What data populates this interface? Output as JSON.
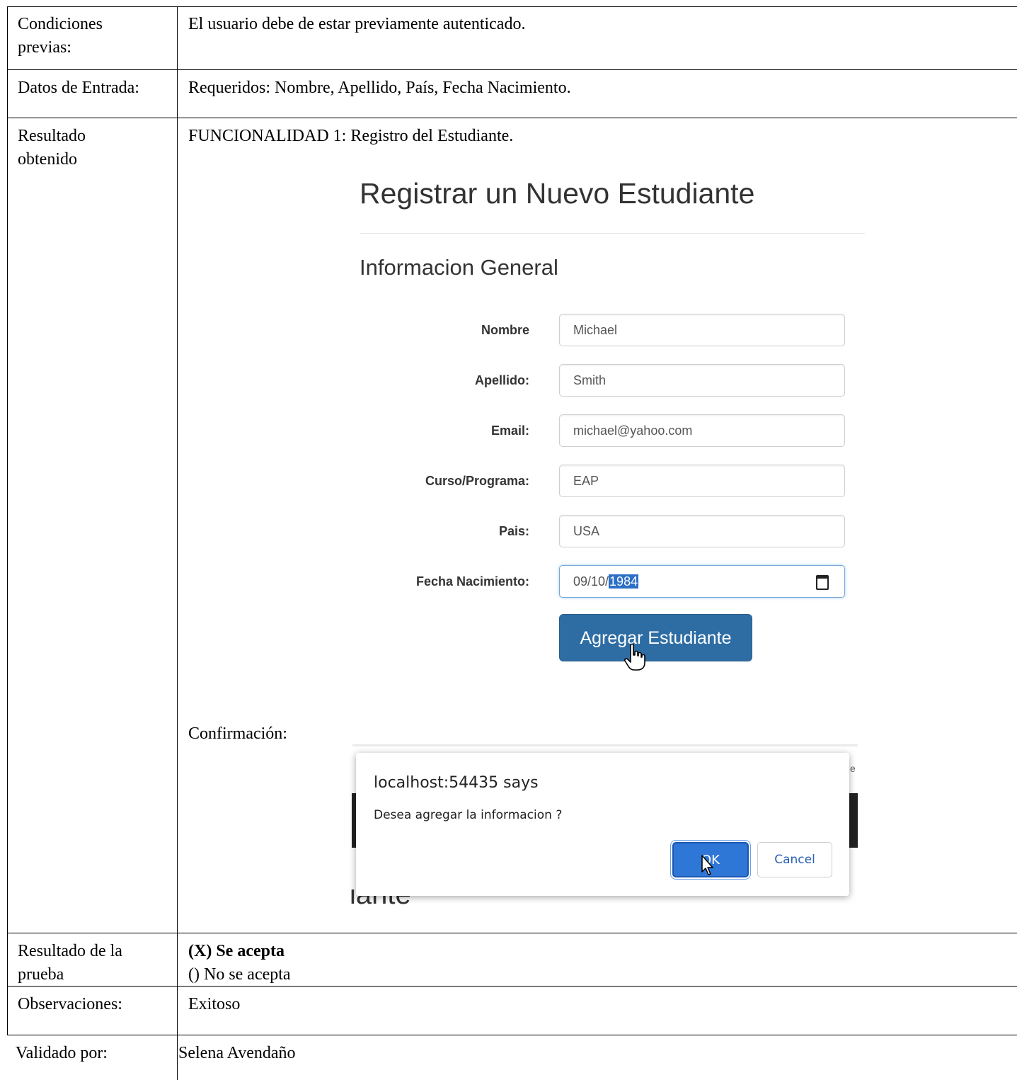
{
  "rows": {
    "precondiciones": {
      "label_line1": "Condiciones",
      "label_line2": "previas:",
      "value": "El usuario debe de estar previamente autenticado."
    },
    "entrada": {
      "label": "Datos de Entrada:",
      "value": "Requeridos: Nombre, Apellido, País, Fecha Nacimiento."
    },
    "resultado_obtenido": {
      "label_line1": "Resultado",
      "label_line2": "obtenido",
      "heading": "FUNCIONALIDAD 1: Registro del Estudiante.",
      "confirmacion_label": "Confirmación:"
    },
    "resultado_prueba": {
      "label_line1": "Resultado de la",
      "label_line2": "prueba",
      "accepted": "(X) Se acepta",
      "rejected": "() No se acepta"
    },
    "observaciones": {
      "label": "Observaciones:",
      "value": "Exitoso"
    },
    "validado": {
      "label": "Validado por:",
      "value": "Selena Avendaño"
    }
  },
  "form": {
    "title": "Registrar un Nuevo Estudiante",
    "subtitle": "Informacion General",
    "fields": [
      {
        "label": "Nombre",
        "value": "Michael"
      },
      {
        "label": "Apellido:",
        "value": "Smith"
      },
      {
        "label": "Email:",
        "value": "michael@yahoo.com"
      },
      {
        "label": "Curso/Programa:",
        "value": "EAP"
      },
      {
        "label": "Pais:",
        "value": "USA"
      },
      {
        "label": "Fecha Nacimiento:",
        "value_prefix": "09/10/",
        "value_selected": "1984"
      }
    ],
    "submit_label": "Agregar Estudiante"
  },
  "dialog": {
    "title": "localhost:54435 says",
    "message": "Desea agregar la informacion ?",
    "ok_label": "OK",
    "cancel_label": "Cancel",
    "background_partial_text": "iante",
    "background_partial_char": "e"
  },
  "icons": [
    "calendar-icon",
    "hand-pointer-cursor-icon",
    "arrow-cursor-icon"
  ]
}
